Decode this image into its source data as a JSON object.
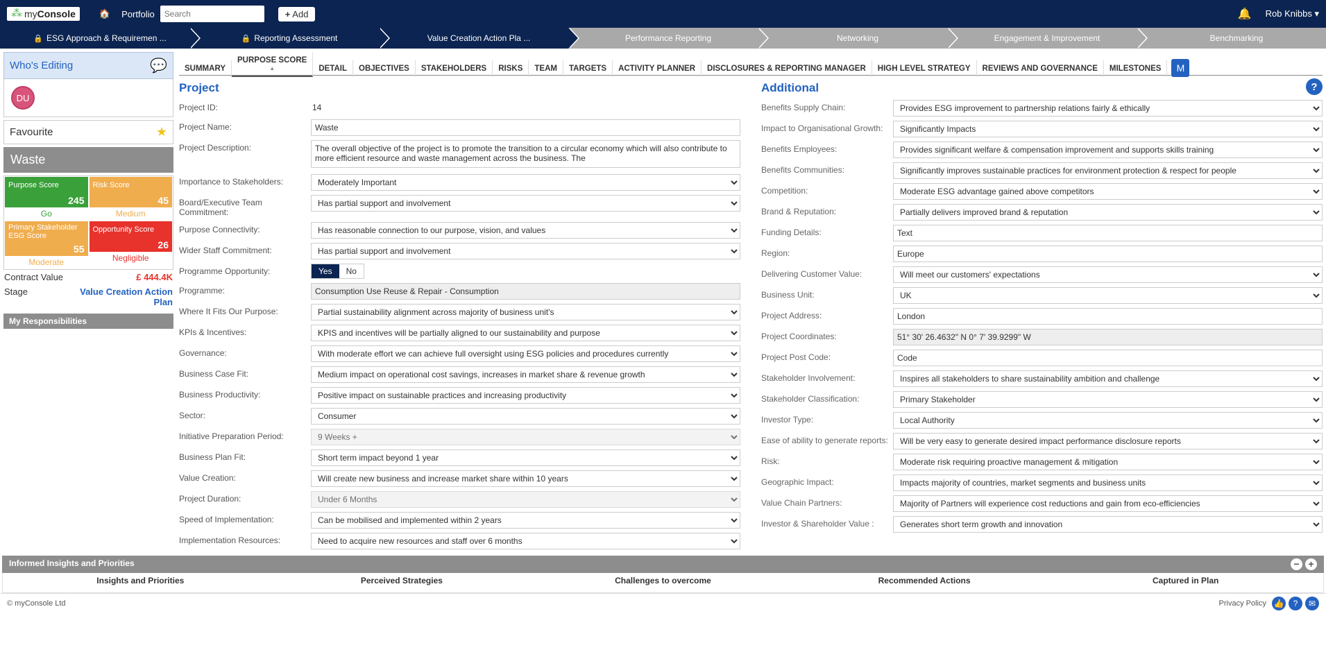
{
  "app": {
    "brand_my": "my",
    "brand_console": "Console",
    "portfolio_label": "Portfolio",
    "search_placeholder": "Search",
    "add_label": "Add",
    "user_name": "Rob Knibbs"
  },
  "chevron": [
    {
      "label": "ESG Approach & Requiremen ...",
      "active": true,
      "locked": true
    },
    {
      "label": "Reporting Assessment",
      "active": true,
      "locked": true
    },
    {
      "label": "Value Creation Action Pla ...",
      "active": true,
      "locked": false
    },
    {
      "label": "Performance Reporting",
      "active": false
    },
    {
      "label": "Networking",
      "active": false
    },
    {
      "label": "Engagement & Improvement",
      "active": false
    },
    {
      "label": "Benchmarking",
      "active": false
    }
  ],
  "sidebar": {
    "whos_editing": "Who's Editing",
    "avatar_initials": "DU",
    "favourite": "Favourite",
    "project_name": "Waste",
    "scores": {
      "purpose": {
        "label": "Purpose Score",
        "value": "245",
        "foot": "Go"
      },
      "risk": {
        "label": "Risk Score",
        "value": "45",
        "foot": "Medium"
      },
      "primary": {
        "label": "Primary Stakeholder ESG Score",
        "value": "55",
        "foot": "Moderate"
      },
      "opportunity": {
        "label": "Opportunity Score",
        "value": "26",
        "foot": "Negligible"
      }
    },
    "contract_label": "Contract Value",
    "contract_value": "£ 444.4K",
    "stage_label": "Stage",
    "stage_value": "Value Creation Action Plan",
    "responsibilities": "My Responsibilities"
  },
  "tabs": [
    "SUMMARY",
    "PURPOSE SCORE",
    "DETAIL",
    "OBJECTIVES",
    "STAKEHOLDERS",
    "RISKS",
    "TEAM",
    "TARGETS",
    "ACTIVITY PLANNER",
    "DISCLOSURES & REPORTING MANAGER",
    "HIGH LEVEL STRATEGY",
    "REVIEWS AND GOVERNANCE",
    "MILESTONES"
  ],
  "project": {
    "title": "Project",
    "fields": {
      "id": {
        "label": "Project ID:",
        "value": "14"
      },
      "name": {
        "label": "Project Name:",
        "value": "Waste"
      },
      "desc": {
        "label": "Project Description:",
        "value": "The overall objective of the project is to promote the transition to a circular economy which will also contribute to more efficient resource and waste management across the business. The"
      },
      "importance": {
        "label": "Importance to Stakeholders:",
        "value": "Moderately Important"
      },
      "board": {
        "label": "Board/Executive Team Commitment:",
        "value": "Has partial support and involvement"
      },
      "purpose_conn": {
        "label": "Purpose Connectivity:",
        "value": "Has reasonable connection to our purpose, vision, and values"
      },
      "wider": {
        "label": "Wider Staff Commitment:",
        "value": "Has partial support and involvement"
      },
      "prog_op": {
        "label": "Programme Opportunity:",
        "yes": "Yes",
        "no": "No"
      },
      "programme": {
        "label": "Programme:",
        "value": "Consumption Use Reuse & Repair - Consumption"
      },
      "fits": {
        "label": "Where It Fits Our Purpose:",
        "value": "Partial sustainability alignment across majority of business unit's"
      },
      "kpis": {
        "label": "KPIs & Incentives:",
        "value": "KPIS and incentives will be partially aligned to our sustainability and purpose"
      },
      "gov": {
        "label": "Governance:",
        "value": "With moderate effort we can achieve full oversight using ESG policies and procedures currently"
      },
      "bcase": {
        "label": "Business Case Fit:",
        "value": "Medium impact on operational cost savings, increases in market share & revenue growth"
      },
      "prod": {
        "label": "Business Productivity:",
        "value": "Positive impact on sustainable practices and increasing productivity"
      },
      "sector": {
        "label": "Sector:",
        "value": "Consumer"
      },
      "init": {
        "label": "Initiative Preparation Period:",
        "value": "9 Weeks +"
      },
      "bplan": {
        "label": "Business Plan Fit:",
        "value": "Short term impact beyond 1 year"
      },
      "vc": {
        "label": "Value Creation:",
        "value": "Will create new business and increase market share within 10 years"
      },
      "dur": {
        "label": "Project Duration:",
        "value": "Under 6 Months"
      },
      "speed": {
        "label": "Speed of Implementation:",
        "value": "Can be mobilised and implemented within 2 years"
      },
      "impl": {
        "label": "Implementation Resources:",
        "value": "Need to acquire new resources and staff over 6 months"
      }
    }
  },
  "additional": {
    "title": "Additional",
    "fields": {
      "supply": {
        "label": "Benefits Supply Chain:",
        "value": "Provides ESG improvement to partnership relations fairly & ethically"
      },
      "impact_org": {
        "label": "Impact to Organisational Growth:",
        "value": "Significantly Impacts"
      },
      "employees": {
        "label": "Benefits Employees:",
        "value": "Provides significant welfare & compensation improvement and supports skills training"
      },
      "communities": {
        "label": "Benefits Communities:",
        "value": "Significantly improves sustainable practices for environment protection & respect for people"
      },
      "competition": {
        "label": "Competition:",
        "value": "Moderate ESG advantage gained above competitors"
      },
      "brand": {
        "label": "Brand & Reputation:",
        "value": "Partially delivers improved brand & reputation"
      },
      "funding": {
        "label": "Funding Details:",
        "value": "Text"
      },
      "region": {
        "label": "Region:",
        "value": "Europe"
      },
      "dcv": {
        "label": "Delivering Customer Value:",
        "value": "Will meet our customers' expectations"
      },
      "bu": {
        "label": "Business Unit:",
        "value": "UK"
      },
      "addr": {
        "label": "Project Address:",
        "value": "London"
      },
      "coords": {
        "label": "Project Coordinates:",
        "value": "51° 30' 26.4632\" N 0° 7' 39.9299\" W"
      },
      "postcode": {
        "label": "Project Post Code:",
        "value": "Code"
      },
      "stake_inv": {
        "label": "Stakeholder Involvement:",
        "value": "Inspires all stakeholders to share sustainability ambition and challenge"
      },
      "stake_class": {
        "label": "Stakeholder Classification:",
        "value": "Primary Stakeholder"
      },
      "inv_type": {
        "label": "Investor Type:",
        "value": "Local Authority"
      },
      "ease": {
        "label": "Ease of ability to generate reports:",
        "value": "Will be very easy to generate desired impact performance disclosure reports"
      },
      "risk": {
        "label": "Risk:",
        "value": "Moderate risk requiring proactive management & mitigation"
      },
      "geo": {
        "label": "Geographic Impact:",
        "value": "Impacts majority of countries, market segments and business units"
      },
      "vcp": {
        "label": "Value Chain Partners:",
        "value": "Majority of Partners will experience cost reductions and gain from eco-efficiencies"
      },
      "isv": {
        "label": "Investor & Shareholder Value :",
        "value": "Generates short term growth and innovation"
      }
    }
  },
  "insights": {
    "bar": "Informed Insights and Priorities",
    "cols": [
      "Insights and Priorities",
      "Perceived Strategies",
      "Challenges to overcome",
      "Recommended Actions",
      "Captured in Plan"
    ]
  },
  "footer": {
    "copyright": "© myConsole Ltd",
    "privacy": "Privacy Policy"
  }
}
